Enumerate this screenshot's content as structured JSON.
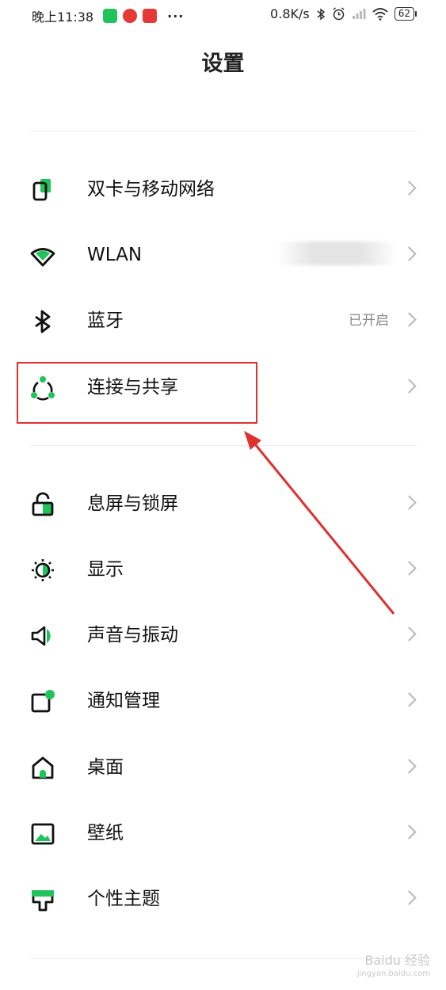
{
  "status_bar": {
    "time": "晚上11:38",
    "dots": "···",
    "speed": "0.8K/s",
    "battery": "62"
  },
  "title": "设置",
  "groups": [
    {
      "items": [
        {
          "label": "双卡与移动网络",
          "icon": "sim-card-icon",
          "value": ""
        },
        {
          "label": "WLAN",
          "icon": "wifi-icon",
          "value": ""
        },
        {
          "label": "蓝牙",
          "icon": "bluetooth-icon",
          "value": "已开启"
        },
        {
          "label": "连接与共享",
          "icon": "connection-share-icon",
          "value": ""
        }
      ]
    },
    {
      "items": [
        {
          "label": "息屏与锁屏",
          "icon": "lock-icon",
          "value": ""
        },
        {
          "label": "显示",
          "icon": "display-brightness-icon",
          "value": ""
        },
        {
          "label": "声音与振动",
          "icon": "speaker-icon",
          "value": ""
        },
        {
          "label": "通知管理",
          "icon": "notification-icon",
          "value": ""
        },
        {
          "label": "桌面",
          "icon": "home-icon",
          "value": ""
        },
        {
          "label": "壁纸",
          "icon": "wallpaper-icon",
          "value": ""
        },
        {
          "label": "个性主题",
          "icon": "theme-icon",
          "value": ""
        }
      ]
    }
  ],
  "watermark": {
    "line1": "Baidu 经验",
    "line2": "jingyan.baidu.com"
  },
  "colors": {
    "accent": "#21c45a",
    "highlight": "#e03030"
  }
}
